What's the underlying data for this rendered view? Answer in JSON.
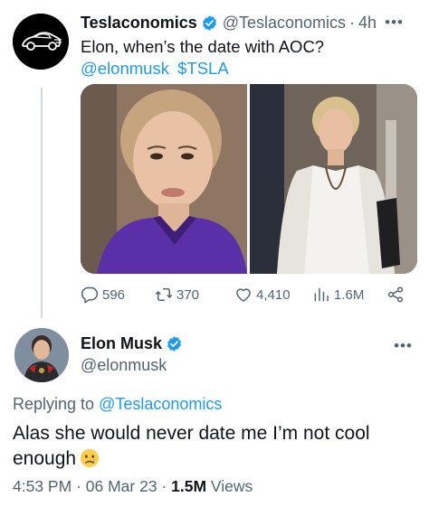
{
  "tweet1": {
    "display_name": "Teslaconomics",
    "handle": "@Teslaconomics",
    "separator": "·",
    "time": "4h",
    "text": "Elon, when’s the date with AOC?",
    "tags": [
      "@elonmusk",
      "$TSLA"
    ],
    "actions": {
      "replies": "596",
      "retweets": "370",
      "likes": "4,410",
      "views": "1.6M"
    }
  },
  "tweet2": {
    "display_name": "Elon Musk",
    "handle": "@elonmusk",
    "replying_prefix": "Replying to",
    "replying_to": "@Teslaconomics",
    "text": "Alas she would never date me I’m not cool enough",
    "emoji": "crying-face",
    "time": "4:53 PM",
    "separator": "·",
    "date": "06 Mar 23",
    "separator2": "·",
    "views_count": "1.5M",
    "views_label": "Views"
  },
  "icons": {
    "verified": "verified-badge-icon",
    "reply": "reply-icon",
    "retweet": "retweet-icon",
    "like": "heart-icon",
    "views": "views-icon",
    "share": "share-icon",
    "more": "more-icon"
  },
  "colors": {
    "text": "#0f1419",
    "secondary": "#536471",
    "link": "#1d9bf0",
    "verified": "#1d9bf0",
    "thread_line": "#cfd9de"
  }
}
